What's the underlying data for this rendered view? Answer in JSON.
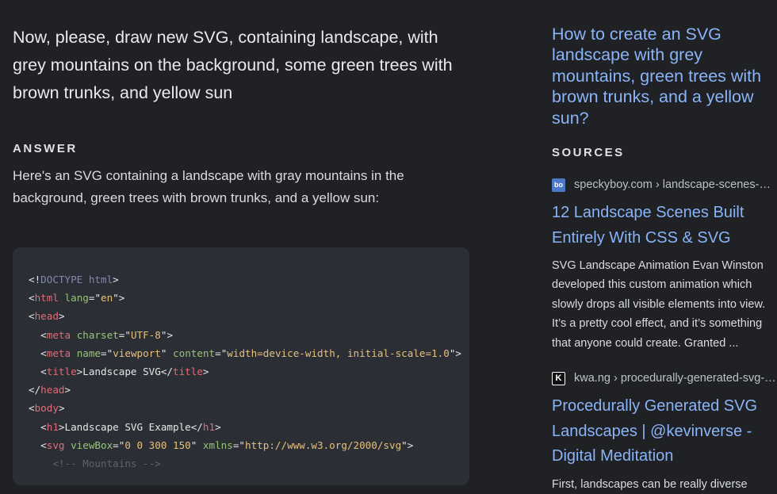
{
  "question": "Now, please, draw new SVG, containing landscape, with grey mountains on the background, some green trees with brown trunks, and yellow sun",
  "answer_label": "ANSWER",
  "answer_text": "Here's an SVG containing a landscape with gray mountains in the background, green trees with brown trunks, and a yellow sun:",
  "code_lines": [
    "<!DOCTYPE html>",
    "<html lang=\"en\">",
    "<head>",
    "  <meta charset=\"UTF-8\">",
    "  <meta name=\"viewport\" content=\"width=device-width, initial-scale=1.0\">",
    "  <title>Landscape SVG</title>",
    "</head>",
    "<body>",
    "  <h1>Landscape SVG Example</h1>",
    "  <svg viewBox=\"0 0 300 150\" xmlns=\"http://www.w3.org/2000/svg\">",
    "    <!-- Mountains -->"
  ],
  "sidebar": {
    "title": "How to create an SVG landscape with grey mountains, green trees with brown trunks, and a yellow sun?",
    "sources_label": "SOURCES",
    "sources": [
      {
        "favicon": "bo",
        "url": "speckyboy.com › landscape-scenes-built-entirely-css-svg",
        "title": "12 Landscape Scenes Built Entirely With CSS & SVG",
        "snippet": "SVG Landscape Animation Evan Winston developed this custom animation which slowly drops all visible elements into view. It’s a pretty cool effect, and it’s something that anyone could create. Granted ..."
      },
      {
        "favicon": "K",
        "url": "kwa.ng › procedurally-generated-svg-landscapes",
        "title": "Procedurally Generated SVG Landscapes | @kevinverse - Digital Meditation",
        "snippet": "First, landscapes can be really diverse"
      }
    ]
  }
}
